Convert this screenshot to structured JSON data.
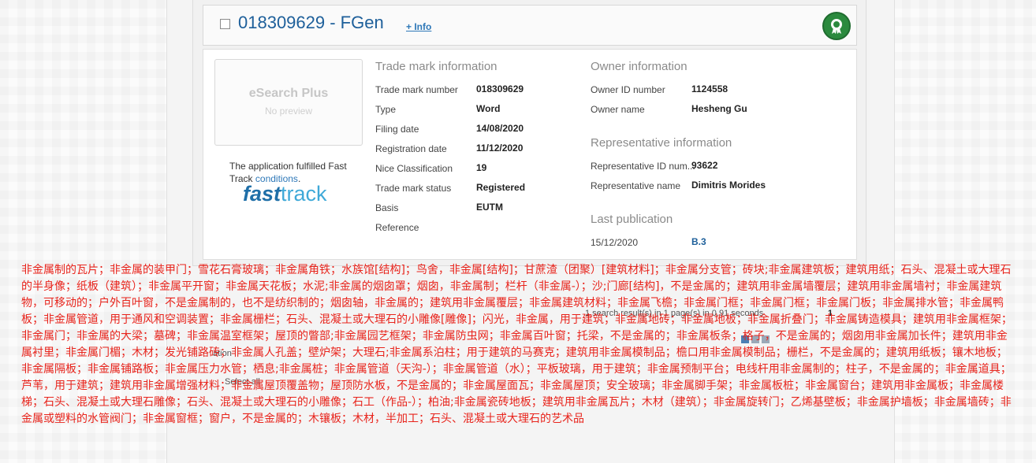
{
  "result": {
    "trademark_title": "018309629 - FGen",
    "info_link": "+ Info",
    "thumbnail": {
      "brand": "eSearch Plus",
      "subtitle": "No preview"
    },
    "fast_track": {
      "text_before": "The application fulfilled Fast Track ",
      "link": "conditions",
      "text_after": ".",
      "logo_word1": "fast",
      "logo_word2": "track"
    },
    "trademark_info": {
      "title": "Trade mark information",
      "rows": [
        {
          "label": "Trade mark number",
          "value": "018309629"
        },
        {
          "label": "Type",
          "value": "Word"
        },
        {
          "label": "Filing date",
          "value": "14/08/2020"
        },
        {
          "label": "Registration date",
          "value": "11/12/2020"
        },
        {
          "label": "Nice Classification",
          "value": "19"
        },
        {
          "label": "Trade mark status",
          "value": "Registered"
        },
        {
          "label": "Basis",
          "value": "EUTM"
        },
        {
          "label": "Reference",
          "value": ""
        }
      ]
    },
    "owner_info": {
      "title": "Owner information",
      "rows": [
        {
          "label": "Owner ID number",
          "value": "1124558"
        },
        {
          "label": "Owner name",
          "value": "Hesheng Gu"
        }
      ]
    },
    "representative_info": {
      "title": "Representative information",
      "rows": [
        {
          "label": "Representative ID num...",
          "value": "93622"
        },
        {
          "label": "Representative name",
          "value": "Dimitris Morides"
        }
      ]
    },
    "last_publication": {
      "title": "Last publication",
      "date": "15/12/2020",
      "code": "B.3"
    }
  },
  "background_controls": {
    "results_summary": "1 search result(s) in 1 page(s) in 0.91 seconds",
    "page_number": "1",
    "select_all": "Select all",
    "options_label": "ation"
  },
  "goods_overlay": {
    "color": "#e8241c",
    "text": "非金属制的瓦片；非金属的装甲门；雪花石膏玻璃；非金属角铁；水族馆[结构]；鸟舍，非金属[结构]；甘蔗渣（团聚）[建筑材料]；非金属分支管；砖块;非金属建筑板；建筑用纸；石头、混凝土或大理石的半身像；纸板（建筑）；非金属平开窗；非金属天花板；水泥;非金属的烟囱罩；烟囱，非金属制；栏杆（非金属-）；沙;门廊[结构]，不是金属的；建筑用非金属墙覆层；建筑用非金属墙衬；非金属建筑物，可移动的；户外百叶窗，不是金属制的，也不是纺织制的；烟囱轴，非金属的；建筑用非金属覆层；非金属建筑材料；非金属飞檐；非金属门框；非金属门框；非金属门板；非金属排水管；非金属鸭板；非金属管道，用于通风和空调装置；非金属栅栏；石头、混凝土或大理石的小雕像[雕像]；闪光，非金属，用于建筑；非金属地砖；非金属地板；非金属折叠门；非金属铸造模具；建筑用非金属框架；非金属门；非金属的大梁；墓碑；非金属温室框架；屋顶的瞥部;非金属园艺框架；非金属防虫网；非金属百叶窗；托梁，不是金属的；非金属板条；格子，不是金属的；烟囱用非金属加长件；建筑用非金属衬里；非金属门楣；木材；发光铺路砖；非金属人孔盖；壁炉架；大理石;非金属系泊柱；用于建筑的马赛克；建筑用非金属模制品；檐口用非金属模制品；栅栏，不是金属的；建筑用纸板；镶木地板；非金属隔板；非金属铺路板；非金属压力水管；栖息;非金属桩；非金属管道（天沟-）；非金属管道（水）；平板玻璃，用于建筑；非金属预制平台；电线杆用非金属制的；柱子，不是金属的；非金属道具；芦苇，用于建筑；建筑用非金属增强材料；非金属屋顶覆盖物；屋顶防水板，不是金属的；非金属屋面瓦；非金属屋顶；安全玻璃；非金属脚手架；非金属板桩；非金属窗台；建筑用非金属板；非金属楼梯；石头、混凝土或大理石雕像；石头、混凝土或大理石的小雕像；石工（作品-）；柏油;非金属瓷砖地板；建筑用非金属瓦片；木材（建筑）；非金属旋转门；乙烯基壁板；非金属护墙板；非金属墙砖；非金属或塑料的水管阀门；非金属窗框；窗户，不是金属的；木镶板；木材，半加工；石头、混凝土或大理石的艺术品"
  }
}
